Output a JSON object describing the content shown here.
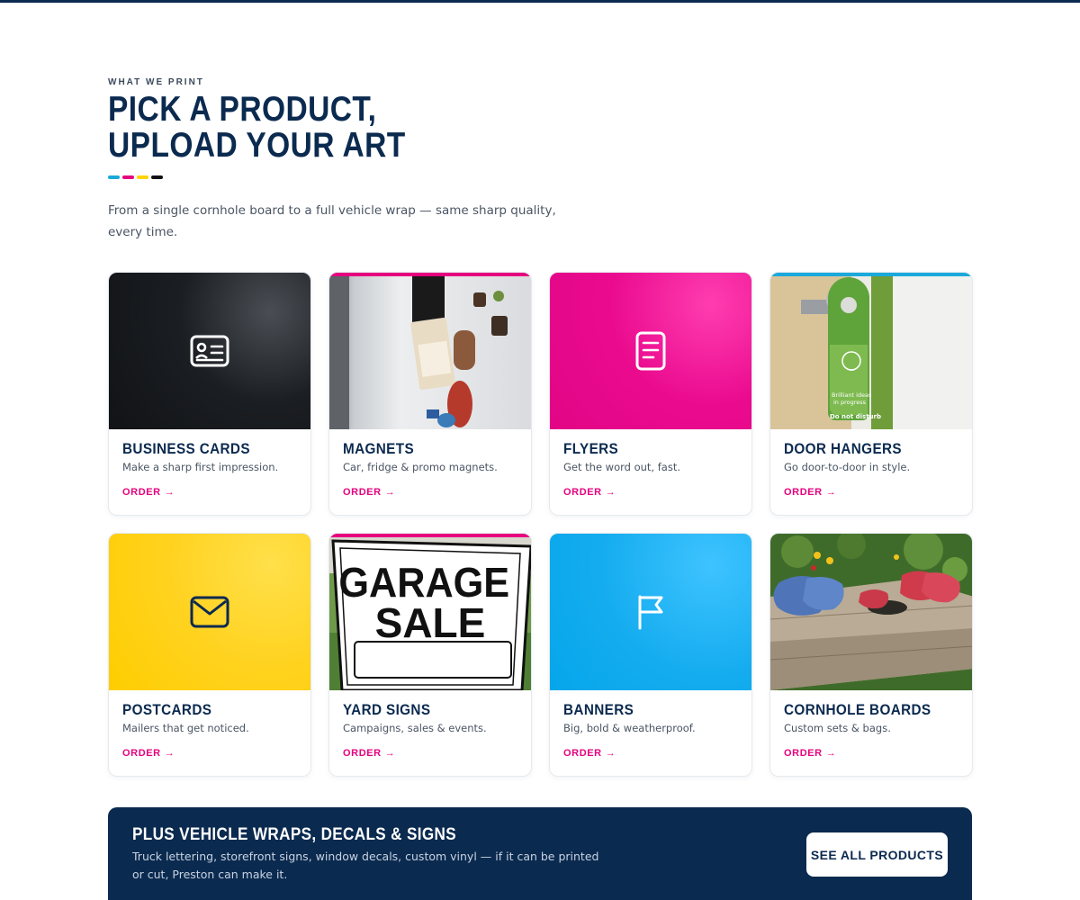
{
  "section": {
    "eyebrow": "WHAT WE PRINT",
    "headline_line1": "PICK A PRODUCT,",
    "headline_line2": "UPLOAD YOUR ART",
    "lead": "From a single cornhole board to a full vehicle wrap — same sharp quality, every time."
  },
  "brand_colors": {
    "navy": "#0b2a4f",
    "cyan": "#1aa9dc",
    "magenta": "#e6007e",
    "yellow": "#ffd400",
    "black": "#111111"
  },
  "products": [
    {
      "title": "BUSINESS CARDS",
      "desc": "Make a sharp first impression.",
      "cta": "ORDER",
      "arrow": "→",
      "icon": "id-card-icon"
    },
    {
      "title": "MAGNETS",
      "desc": "Car, fridge & promo magnets.",
      "cta": "ORDER",
      "arrow": "→",
      "icon": "magnets-photo"
    },
    {
      "title": "FLYERS",
      "desc": "Get the word out, fast.",
      "cta": "ORDER",
      "arrow": "→",
      "icon": "document-icon"
    },
    {
      "title": "DOOR HANGERS",
      "desc": "Go door-to-door in style.",
      "cta": "ORDER",
      "arrow": "→",
      "icon": "door-hanger-photo",
      "photo_text": [
        "Brilliant ideas",
        "in progress",
        "Do not disturb"
      ]
    },
    {
      "title": "POSTCARDS",
      "desc": "Mailers that get noticed.",
      "cta": "ORDER",
      "arrow": "→",
      "icon": "envelope-icon"
    },
    {
      "title": "YARD SIGNS",
      "desc": "Campaigns, sales & events.",
      "cta": "ORDER",
      "arrow": "→",
      "icon": "yard-sign-photo",
      "photo_text": [
        "GARAGE",
        "SALE"
      ]
    },
    {
      "title": "BANNERS",
      "desc": "Big, bold & weatherproof.",
      "cta": "ORDER",
      "arrow": "→",
      "icon": "flag-icon"
    },
    {
      "title": "CORNHOLE BOARDS",
      "desc": "Custom sets & bags.",
      "cta": "ORDER",
      "arrow": "→",
      "icon": "cornhole-photo"
    }
  ],
  "banner": {
    "title": "PLUS VEHICLE WRAPS, DECALS & SIGNS",
    "text": "Truck lettering, storefront signs, window decals, custom vinyl — if it can be printed or cut, Preston can make it.",
    "button": "SEE ALL PRODUCTS"
  }
}
